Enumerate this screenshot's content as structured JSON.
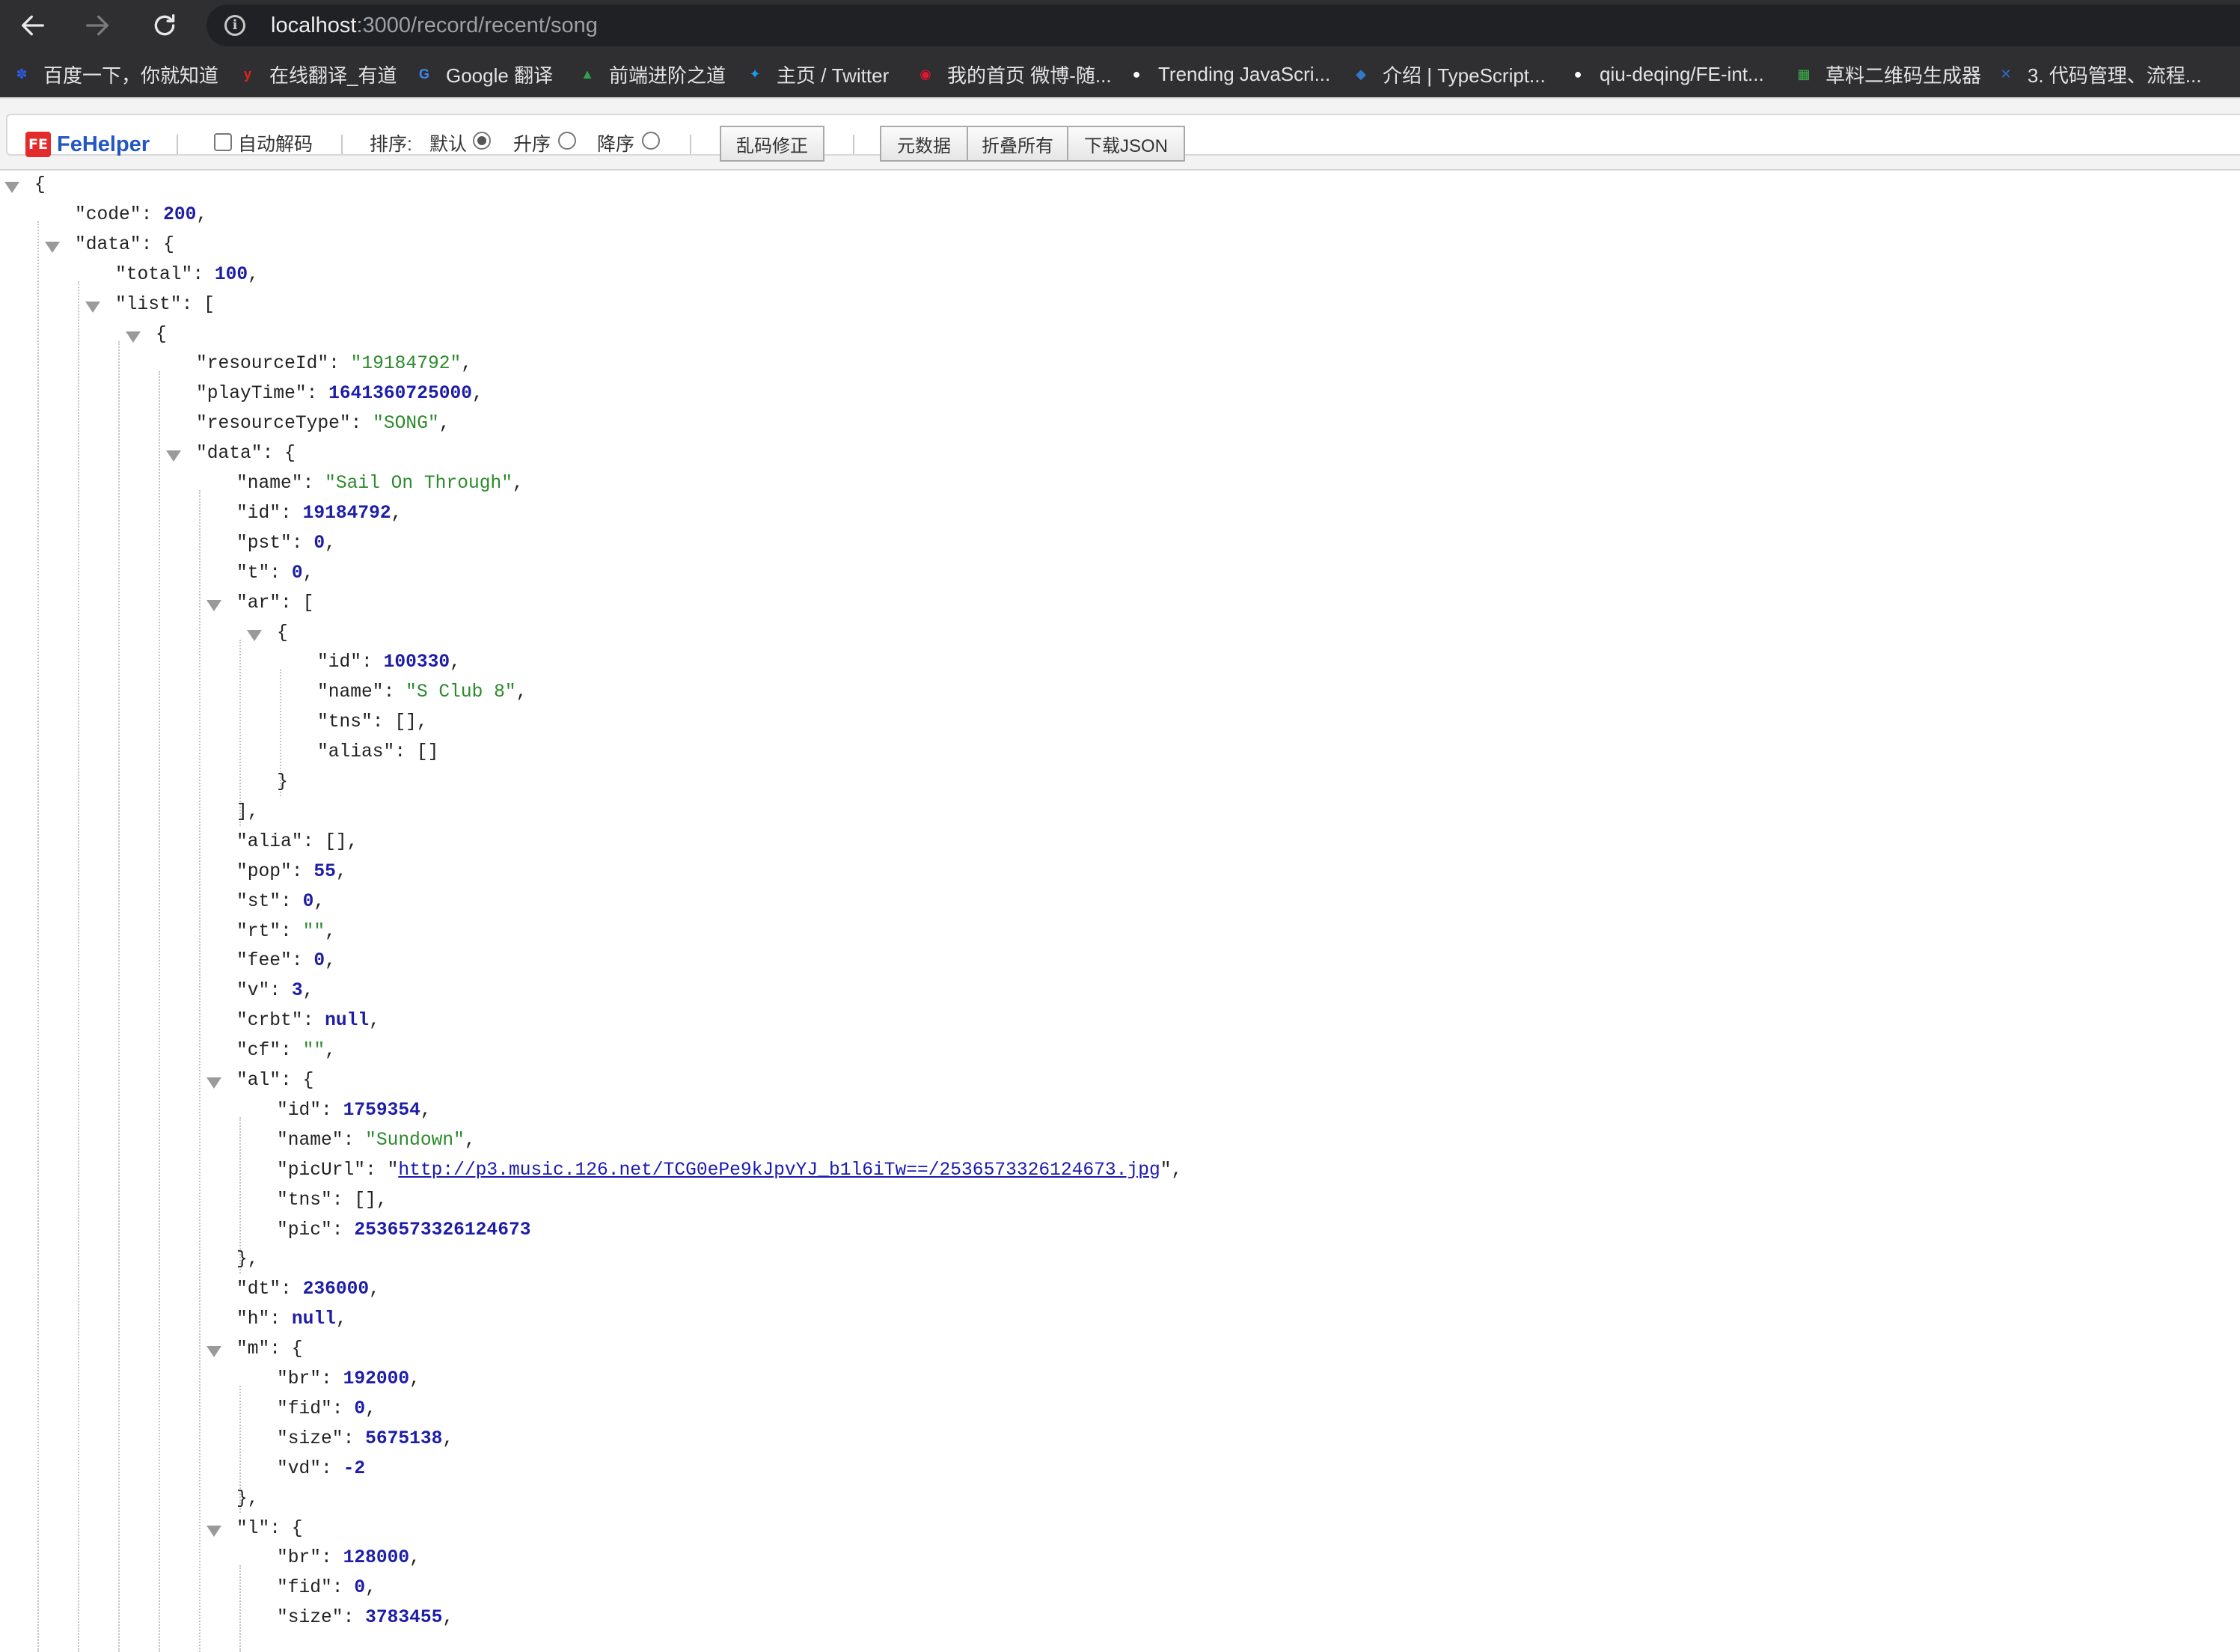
{
  "browser": {
    "url_host": "localhost",
    "url_path": ":3000/record/recent/song",
    "bookmarks": [
      {
        "label": "百度一下，你就知道",
        "icon": "baidu-paw-icon",
        "color": "#2d5be3"
      },
      {
        "label": "在线翻译_有道",
        "icon": "youdao-y-icon",
        "color": "#e2231a"
      },
      {
        "label": "Google 翻译",
        "icon": "google-translate-icon",
        "color": "#4285f4"
      },
      {
        "label": "前端进阶之道",
        "icon": "triangle-logo-icon",
        "color": "#2ea44f"
      },
      {
        "label": "主页 / Twitter",
        "icon": "twitter-bird-icon",
        "color": "#1d9bf0"
      },
      {
        "label": "我的首页 微博-随...",
        "icon": "weibo-icon",
        "color": "#e6162d"
      },
      {
        "label": "Trending JavaScri...",
        "icon": "github-icon",
        "color": "#ffffff"
      },
      {
        "label": "介绍 | TypeScript...",
        "icon": "layers-icon",
        "color": "#3178c6"
      },
      {
        "label": "qiu-deqing/FE-int...",
        "icon": "github-icon",
        "color": "#ffffff"
      },
      {
        "label": "草料二维码生成器",
        "icon": "qrcode-icon",
        "color": "#3cb44b"
      },
      {
        "label": "3. 代码管理、流程...",
        "icon": "x-logo-icon",
        "color": "#2e6bd6"
      }
    ]
  },
  "fehelper": {
    "logo_icon": "FE",
    "logo_text": "FeHelper",
    "auto_decode_label": "自动解码",
    "sort_label": "排序:",
    "sort_default": "默认",
    "sort_asc": "升序",
    "sort_desc": "降序",
    "fix_encoding_button": "乱码修正",
    "raw_data_button": "元数据",
    "collapse_all_button": "折叠所有",
    "download_json_button": "下载JSON"
  },
  "json_lines": [
    {
      "indent": 0,
      "collapsible": true,
      "parts": [
        {
          "t": "p",
          "v": "{"
        }
      ]
    },
    {
      "indent": 1,
      "parts": [
        {
          "t": "k",
          "v": "\"code\""
        },
        {
          "t": "p",
          "v": ": "
        },
        {
          "t": "n",
          "v": "200"
        },
        {
          "t": "p",
          "v": ","
        }
      ]
    },
    {
      "indent": 1,
      "collapsible": true,
      "parts": [
        {
          "t": "k",
          "v": "\"data\""
        },
        {
          "t": "p",
          "v": ": {"
        }
      ]
    },
    {
      "indent": 2,
      "parts": [
        {
          "t": "k",
          "v": "\"total\""
        },
        {
          "t": "p",
          "v": ": "
        },
        {
          "t": "n",
          "v": "100"
        },
        {
          "t": "p",
          "v": ","
        }
      ]
    },
    {
      "indent": 2,
      "collapsible": true,
      "parts": [
        {
          "t": "k",
          "v": "\"list\""
        },
        {
          "t": "p",
          "v": ": ["
        }
      ]
    },
    {
      "indent": 3,
      "collapsible": true,
      "parts": [
        {
          "t": "p",
          "v": "{"
        }
      ]
    },
    {
      "indent": 4,
      "parts": [
        {
          "t": "k",
          "v": "\"resourceId\""
        },
        {
          "t": "p",
          "v": ": "
        },
        {
          "t": "s",
          "v": "\"19184792\""
        },
        {
          "t": "p",
          "v": ","
        }
      ]
    },
    {
      "indent": 4,
      "parts": [
        {
          "t": "k",
          "v": "\"playTime\""
        },
        {
          "t": "p",
          "v": ": "
        },
        {
          "t": "n",
          "v": "1641360725000"
        },
        {
          "t": "p",
          "v": ","
        }
      ]
    },
    {
      "indent": 4,
      "parts": [
        {
          "t": "k",
          "v": "\"resourceType\""
        },
        {
          "t": "p",
          "v": ": "
        },
        {
          "t": "s",
          "v": "\"SONG\""
        },
        {
          "t": "p",
          "v": ","
        }
      ]
    },
    {
      "indent": 4,
      "collapsible": true,
      "parts": [
        {
          "t": "k",
          "v": "\"data\""
        },
        {
          "t": "p",
          "v": ": {"
        }
      ]
    },
    {
      "indent": 5,
      "parts": [
        {
          "t": "k",
          "v": "\"name\""
        },
        {
          "t": "p",
          "v": ": "
        },
        {
          "t": "s",
          "v": "\"Sail On Through\""
        },
        {
          "t": "p",
          "v": ","
        }
      ]
    },
    {
      "indent": 5,
      "parts": [
        {
          "t": "k",
          "v": "\"id\""
        },
        {
          "t": "p",
          "v": ": "
        },
        {
          "t": "n",
          "v": "19184792"
        },
        {
          "t": "p",
          "v": ","
        }
      ]
    },
    {
      "indent": 5,
      "parts": [
        {
          "t": "k",
          "v": "\"pst\""
        },
        {
          "t": "p",
          "v": ": "
        },
        {
          "t": "n",
          "v": "0"
        },
        {
          "t": "p",
          "v": ","
        }
      ]
    },
    {
      "indent": 5,
      "parts": [
        {
          "t": "k",
          "v": "\"t\""
        },
        {
          "t": "p",
          "v": ": "
        },
        {
          "t": "n",
          "v": "0"
        },
        {
          "t": "p",
          "v": ","
        }
      ]
    },
    {
      "indent": 5,
      "collapsible": true,
      "parts": [
        {
          "t": "k",
          "v": "\"ar\""
        },
        {
          "t": "p",
          "v": ": ["
        }
      ]
    },
    {
      "indent": 6,
      "collapsible": true,
      "parts": [
        {
          "t": "p",
          "v": "{"
        }
      ]
    },
    {
      "indent": 7,
      "parts": [
        {
          "t": "k",
          "v": "\"id\""
        },
        {
          "t": "p",
          "v": ": "
        },
        {
          "t": "n",
          "v": "100330"
        },
        {
          "t": "p",
          "v": ","
        }
      ]
    },
    {
      "indent": 7,
      "parts": [
        {
          "t": "k",
          "v": "\"name\""
        },
        {
          "t": "p",
          "v": ": "
        },
        {
          "t": "s",
          "v": "\"S Club 8\""
        },
        {
          "t": "p",
          "v": ","
        }
      ]
    },
    {
      "indent": 7,
      "parts": [
        {
          "t": "k",
          "v": "\"tns\""
        },
        {
          "t": "p",
          "v": ": [],"
        }
      ]
    },
    {
      "indent": 7,
      "parts": [
        {
          "t": "k",
          "v": "\"alias\""
        },
        {
          "t": "p",
          "v": ": []"
        }
      ]
    },
    {
      "indent": 6,
      "parts": [
        {
          "t": "p",
          "v": "}"
        }
      ]
    },
    {
      "indent": 5,
      "parts": [
        {
          "t": "p",
          "v": "],"
        }
      ]
    },
    {
      "indent": 5,
      "parts": [
        {
          "t": "k",
          "v": "\"alia\""
        },
        {
          "t": "p",
          "v": ": [],"
        }
      ]
    },
    {
      "indent": 5,
      "parts": [
        {
          "t": "k",
          "v": "\"pop\""
        },
        {
          "t": "p",
          "v": ": "
        },
        {
          "t": "n",
          "v": "55"
        },
        {
          "t": "p",
          "v": ","
        }
      ]
    },
    {
      "indent": 5,
      "parts": [
        {
          "t": "k",
          "v": "\"st\""
        },
        {
          "t": "p",
          "v": ": "
        },
        {
          "t": "n",
          "v": "0"
        },
        {
          "t": "p",
          "v": ","
        }
      ]
    },
    {
      "indent": 5,
      "parts": [
        {
          "t": "k",
          "v": "\"rt\""
        },
        {
          "t": "p",
          "v": ": "
        },
        {
          "t": "s",
          "v": "\"\""
        },
        {
          "t": "p",
          "v": ","
        }
      ]
    },
    {
      "indent": 5,
      "parts": [
        {
          "t": "k",
          "v": "\"fee\""
        },
        {
          "t": "p",
          "v": ": "
        },
        {
          "t": "n",
          "v": "0"
        },
        {
          "t": "p",
          "v": ","
        }
      ]
    },
    {
      "indent": 5,
      "parts": [
        {
          "t": "k",
          "v": "\"v\""
        },
        {
          "t": "p",
          "v": ": "
        },
        {
          "t": "n",
          "v": "3"
        },
        {
          "t": "p",
          "v": ","
        }
      ]
    },
    {
      "indent": 5,
      "parts": [
        {
          "t": "k",
          "v": "\"crbt\""
        },
        {
          "t": "p",
          "v": ": "
        },
        {
          "t": "b",
          "v": "null"
        },
        {
          "t": "p",
          "v": ","
        }
      ]
    },
    {
      "indent": 5,
      "parts": [
        {
          "t": "k",
          "v": "\"cf\""
        },
        {
          "t": "p",
          "v": ": "
        },
        {
          "t": "s",
          "v": "\"\""
        },
        {
          "t": "p",
          "v": ","
        }
      ]
    },
    {
      "indent": 5,
      "collapsible": true,
      "parts": [
        {
          "t": "k",
          "v": "\"al\""
        },
        {
          "t": "p",
          "v": ": {"
        }
      ]
    },
    {
      "indent": 6,
      "parts": [
        {
          "t": "k",
          "v": "\"id\""
        },
        {
          "t": "p",
          "v": ": "
        },
        {
          "t": "n",
          "v": "1759354"
        },
        {
          "t": "p",
          "v": ","
        }
      ]
    },
    {
      "indent": 6,
      "parts": [
        {
          "t": "k",
          "v": "\"name\""
        },
        {
          "t": "p",
          "v": ": "
        },
        {
          "t": "s",
          "v": "\"Sundown\""
        },
        {
          "t": "p",
          "v": ","
        }
      ]
    },
    {
      "indent": 6,
      "parts": [
        {
          "t": "k",
          "v": "\"picUrl\""
        },
        {
          "t": "p",
          "v": ": \""
        },
        {
          "t": "u",
          "v": "http://p3.music.126.net/TCG0ePe9kJpvYJ_b1l6iTw==/2536573326124673.jpg"
        },
        {
          "t": "p",
          "v": "\","
        }
      ]
    },
    {
      "indent": 6,
      "parts": [
        {
          "t": "k",
          "v": "\"tns\""
        },
        {
          "t": "p",
          "v": ": [],"
        }
      ]
    },
    {
      "indent": 6,
      "parts": [
        {
          "t": "k",
          "v": "\"pic\""
        },
        {
          "t": "p",
          "v": ": "
        },
        {
          "t": "n",
          "v": "2536573326124673"
        }
      ]
    },
    {
      "indent": 5,
      "parts": [
        {
          "t": "p",
          "v": "},"
        }
      ]
    },
    {
      "indent": 5,
      "parts": [
        {
          "t": "k",
          "v": "\"dt\""
        },
        {
          "t": "p",
          "v": ": "
        },
        {
          "t": "n",
          "v": "236000"
        },
        {
          "t": "p",
          "v": ","
        }
      ]
    },
    {
      "indent": 5,
      "parts": [
        {
          "t": "k",
          "v": "\"h\""
        },
        {
          "t": "p",
          "v": ": "
        },
        {
          "t": "b",
          "v": "null"
        },
        {
          "t": "p",
          "v": ","
        }
      ]
    },
    {
      "indent": 5,
      "collapsible": true,
      "parts": [
        {
          "t": "k",
          "v": "\"m\""
        },
        {
          "t": "p",
          "v": ": {"
        }
      ]
    },
    {
      "indent": 6,
      "parts": [
        {
          "t": "k",
          "v": "\"br\""
        },
        {
          "t": "p",
          "v": ": "
        },
        {
          "t": "n",
          "v": "192000"
        },
        {
          "t": "p",
          "v": ","
        }
      ]
    },
    {
      "indent": 6,
      "parts": [
        {
          "t": "k",
          "v": "\"fid\""
        },
        {
          "t": "p",
          "v": ": "
        },
        {
          "t": "n",
          "v": "0"
        },
        {
          "t": "p",
          "v": ","
        }
      ]
    },
    {
      "indent": 6,
      "parts": [
        {
          "t": "k",
          "v": "\"size\""
        },
        {
          "t": "p",
          "v": ": "
        },
        {
          "t": "n",
          "v": "5675138"
        },
        {
          "t": "p",
          "v": ","
        }
      ]
    },
    {
      "indent": 6,
      "parts": [
        {
          "t": "k",
          "v": "\"vd\""
        },
        {
          "t": "p",
          "v": ": "
        },
        {
          "t": "n",
          "v": "-2"
        }
      ]
    },
    {
      "indent": 5,
      "parts": [
        {
          "t": "p",
          "v": "},"
        }
      ]
    },
    {
      "indent": 5,
      "collapsible": true,
      "parts": [
        {
          "t": "k",
          "v": "\"l\""
        },
        {
          "t": "p",
          "v": ": {"
        }
      ]
    },
    {
      "indent": 6,
      "parts": [
        {
          "t": "k",
          "v": "\"br\""
        },
        {
          "t": "p",
          "v": ": "
        },
        {
          "t": "n",
          "v": "128000"
        },
        {
          "t": "p",
          "v": ","
        }
      ]
    },
    {
      "indent": 6,
      "parts": [
        {
          "t": "k",
          "v": "\"fid\""
        },
        {
          "t": "p",
          "v": ": "
        },
        {
          "t": "n",
          "v": "0"
        },
        {
          "t": "p",
          "v": ","
        }
      ]
    },
    {
      "indent": 6,
      "parts": [
        {
          "t": "k",
          "v": "\"size\""
        },
        {
          "t": "p",
          "v": ": "
        },
        {
          "t": "n",
          "v": "3783455"
        },
        {
          "t": "p",
          "v": ","
        }
      ]
    }
  ]
}
